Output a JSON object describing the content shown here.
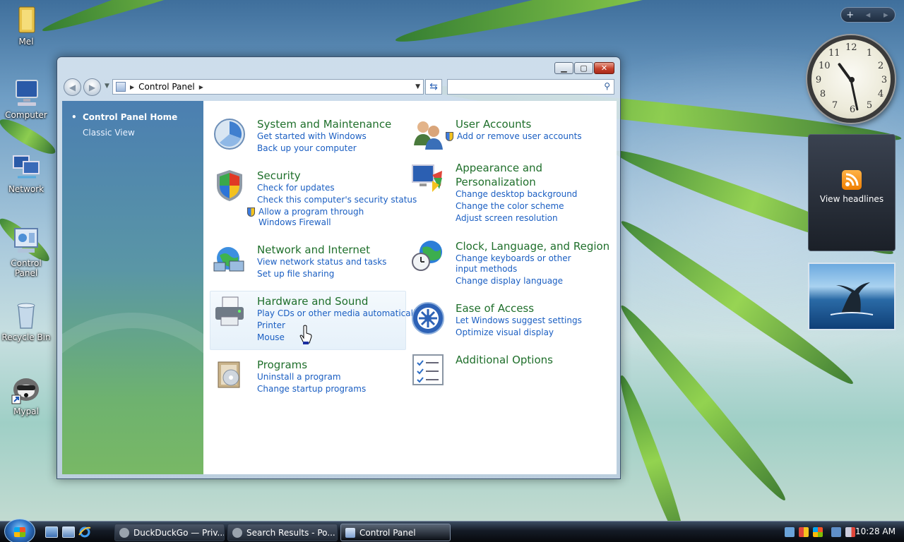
{
  "desktop": {
    "icons": [
      {
        "label": "Mel"
      },
      {
        "label": "Computer"
      },
      {
        "label": "Network"
      },
      {
        "label": "Control Panel"
      },
      {
        "label": "Recycle Bin"
      },
      {
        "label": "Mypal"
      }
    ]
  },
  "gadgets": {
    "bar": {
      "add": "+",
      "prev": "◂",
      "next": "▸"
    },
    "clock": {
      "numbers": [
        "12",
        "1",
        "2",
        "3",
        "4",
        "5",
        "6",
        "7",
        "8",
        "9",
        "10",
        "11"
      ],
      "time": "10:28"
    },
    "feed": {
      "label": "View headlines"
    }
  },
  "window": {
    "breadcrumb": "Control Panel",
    "search": {
      "placeholder": "",
      "value": ""
    },
    "sidebar": {
      "home": "Control Panel Home",
      "classic": "Classic View"
    },
    "categories": [
      {
        "title": "System and Maintenance",
        "links": [
          "Get started with Windows",
          "Back up your computer"
        ]
      },
      {
        "title": "Security",
        "links": [
          "Check for updates",
          "Check this computer's security status",
          "Allow a program through Windows Firewall"
        ]
      },
      {
        "title": "Network and Internet",
        "links": [
          "View network status and tasks",
          "Set up file sharing"
        ]
      },
      {
        "title": "Hardware and Sound",
        "links": [
          "Play CDs or other media automatically",
          "Printer",
          "Mouse"
        ]
      },
      {
        "title": "Programs",
        "links": [
          "Uninstall a program",
          "Change startup programs"
        ]
      },
      {
        "title": "User Accounts",
        "links": [
          "Add or remove user accounts"
        ]
      },
      {
        "title": "Appearance and Personalization",
        "links": [
          "Change desktop background",
          "Change the color scheme",
          "Adjust screen resolution"
        ]
      },
      {
        "title": "Clock, Language, and Region",
        "links": [
          "Change keyboards or other input methods",
          "Change display language"
        ]
      },
      {
        "title": "Ease of Access",
        "links": [
          "Let Windows suggest settings",
          "Optimize visual display"
        ]
      },
      {
        "title": "Additional Options",
        "links": []
      }
    ]
  },
  "taskbar": {
    "tasks": [
      {
        "label": "DuckDuckGo — Priv..."
      },
      {
        "label": "Search Results - Po..."
      },
      {
        "label": "Control Panel"
      }
    ],
    "clock": "10:28 AM"
  },
  "colors": {
    "category_title": "#1f6f2b",
    "link": "#1a5ec2"
  }
}
